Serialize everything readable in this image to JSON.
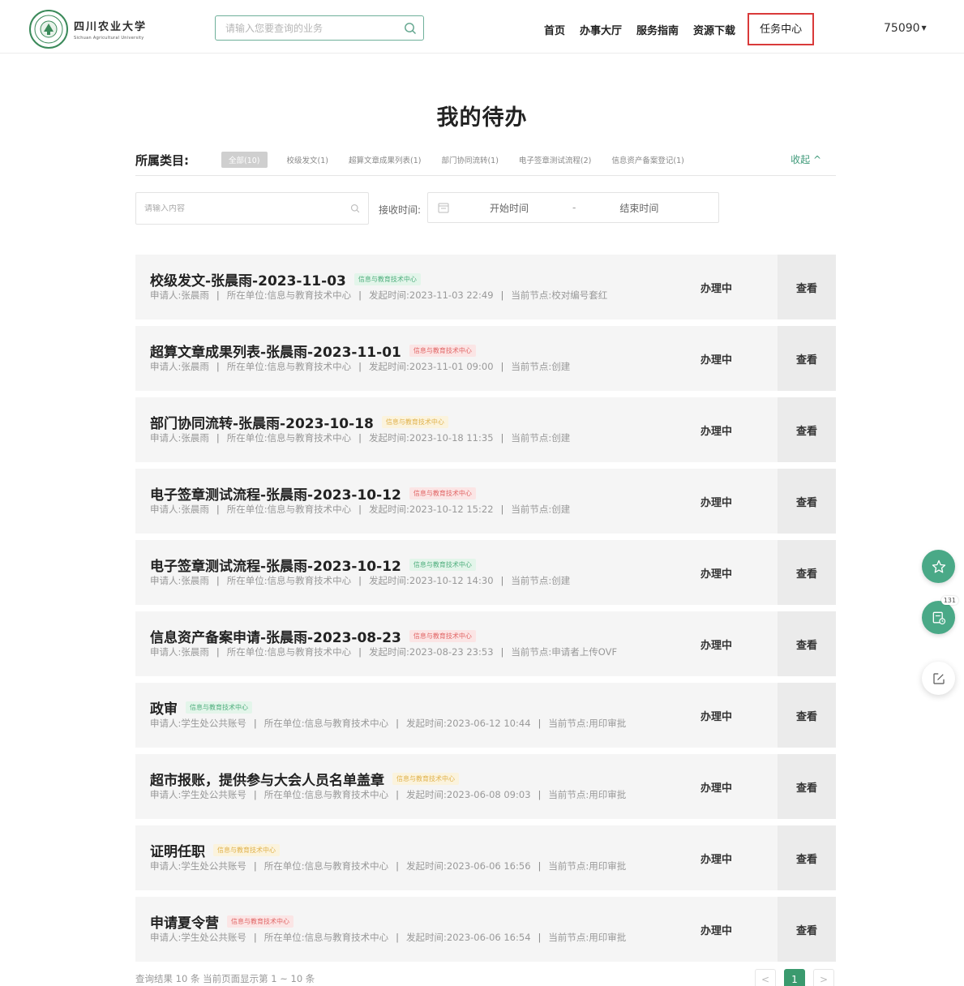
{
  "header": {
    "logo": {
      "cn": "四川农业大学",
      "en": "Sichuan Agricultural University"
    },
    "search_placeholder": "请输入您要查询的业务",
    "nav": [
      {
        "label": "首页"
      },
      {
        "label": "办事大厅"
      },
      {
        "label": "服务指南"
      },
      {
        "label": "资源下载"
      },
      {
        "label": "任务中心",
        "active": true
      }
    ],
    "user": "75090"
  },
  "page_title": "我的待办",
  "categories": {
    "label": "所属类目:",
    "items": [
      "全部(10)",
      "校级发文(1)",
      "超算文章成果列表(1)",
      "部门协同流转(1)",
      "电子签章测试流程(2)",
      "信息资产备案登记(1)"
    ],
    "collapse": "收起"
  },
  "filter": {
    "search_placeholder": "请输入内容",
    "recv_label": "接收时间:",
    "start": "开始时间",
    "sep": "-",
    "end": "结束时间"
  },
  "meta_labels": {
    "applicant": "申请人:",
    "unit": "所在单位:",
    "time": "发起时间:",
    "node": "当前节点:"
  },
  "tasks": [
    {
      "title": "校级发文-张晨雨-2023-11-03",
      "tag": "信息与教育技术中心",
      "tag_color": "green",
      "applicant": "张晨雨",
      "unit": "信息与教育技术中心",
      "time": "2023-11-03 22:49",
      "node": "校对编号套红",
      "status": "办理中",
      "action": "查看"
    },
    {
      "title": "超算文章成果列表-张晨雨-2023-11-01",
      "tag": "信息与教育技术中心",
      "tag_color": "red",
      "applicant": "张晨雨",
      "unit": "信息与教育技术中心",
      "time": "2023-11-01 09:00",
      "node": "创建",
      "status": "办理中",
      "action": "查看"
    },
    {
      "title": "部门协同流转-张晨雨-2023-10-18",
      "tag": "信息与教育技术中心",
      "tag_color": "yellow",
      "applicant": "张晨雨",
      "unit": "信息与教育技术中心",
      "time": "2023-10-18 11:35",
      "node": "创建",
      "status": "办理中",
      "action": "查看"
    },
    {
      "title": "电子签章测试流程-张晨雨-2023-10-12",
      "tag": "信息与教育技术中心",
      "tag_color": "red",
      "applicant": "张晨雨",
      "unit": "信息与教育技术中心",
      "time": "2023-10-12 15:22",
      "node": "创建",
      "status": "办理中",
      "action": "查看"
    },
    {
      "title": "电子签章测试流程-张晨雨-2023-10-12",
      "tag": "信息与教育技术中心",
      "tag_color": "green",
      "applicant": "张晨雨",
      "unit": "信息与教育技术中心",
      "time": "2023-10-12 14:30",
      "node": "创建",
      "status": "办理中",
      "action": "查看"
    },
    {
      "title": "信息资产备案申请-张晨雨-2023-08-23",
      "tag": "信息与教育技术中心",
      "tag_color": "red",
      "applicant": "张晨雨",
      "unit": "信息与教育技术中心",
      "time": "2023-08-23 23:53",
      "node": "申请者上传OVF",
      "status": "办理中",
      "action": "查看"
    },
    {
      "title": "政审",
      "tag": "信息与教育技术中心",
      "tag_color": "green",
      "applicant": "学生处公共账号",
      "unit": "信息与教育技术中心",
      "time": "2023-06-12 10:44",
      "node": "用印审批",
      "status": "办理中",
      "action": "查看"
    },
    {
      "title": "超市报账，提供参与大会人员名单盖章",
      "tag": "信息与教育技术中心",
      "tag_color": "yellow",
      "applicant": "学生处公共账号",
      "unit": "信息与教育技术中心",
      "time": "2023-06-08 09:03",
      "node": "用印审批",
      "status": "办理中",
      "action": "查看"
    },
    {
      "title": "证明任职",
      "tag": "信息与教育技术中心",
      "tag_color": "yellow",
      "applicant": "学生处公共账号",
      "unit": "信息与教育技术中心",
      "time": "2023-06-06 16:56",
      "node": "用印审批",
      "status": "办理中",
      "action": "查看"
    },
    {
      "title": "申请夏令营",
      "tag": "信息与教育技术中心",
      "tag_color": "red",
      "applicant": "学生处公共账号",
      "unit": "信息与教育技术中心",
      "time": "2023-06-06 16:54",
      "node": "用印审批",
      "status": "办理中",
      "action": "查看"
    }
  ],
  "footer": {
    "info": "查询结果 10 条 当前页面显示第 1 ~ 10 条",
    "prev": "<",
    "current_page": "1",
    "next": ">"
  },
  "floating": {
    "favorite_icon": "star-icon",
    "todo_icon": "task-clock-icon",
    "todo_badge": "131",
    "edit_icon": "edit-icon"
  },
  "colors": {
    "accent": "#3a9a6e",
    "active_nav_border": "#d93a3a",
    "row_bg": "#f5f5f5"
  }
}
